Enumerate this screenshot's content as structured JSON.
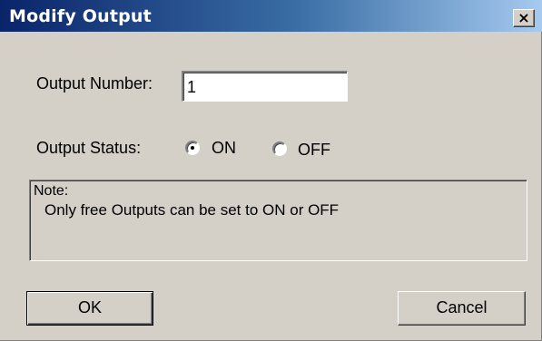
{
  "window": {
    "title": "Modify Output",
    "close_glyph": "×"
  },
  "form": {
    "number_label": "Output Number:",
    "number_value": "1",
    "status_label": "Output Status:",
    "status_options": [
      {
        "label": "ON",
        "checked": true
      },
      {
        "label": "OFF",
        "checked": false
      }
    ]
  },
  "note": {
    "title": "Note:",
    "text": "Only free Outputs can be set to ON or OFF"
  },
  "buttons": {
    "ok_label": "OK",
    "cancel_label": "Cancel"
  },
  "colors": {
    "face": "#d4d0c8",
    "titlebar_start": "#0a246a",
    "titlebar_end": "#a6caf0"
  }
}
